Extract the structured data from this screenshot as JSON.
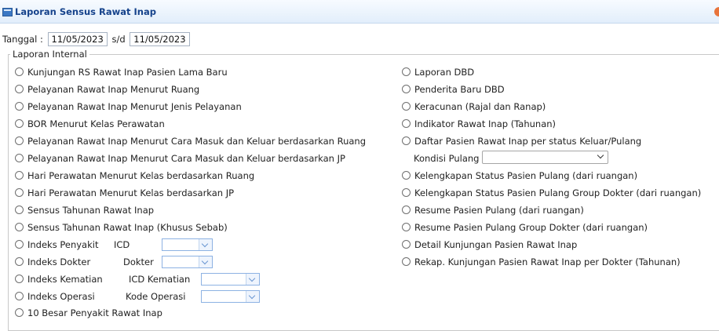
{
  "window": {
    "title": "Laporan Sensus Rawat Inap"
  },
  "filter": {
    "tanggal_label": "Tanggal :",
    "date_from": "11/05/2023",
    "sd_label": "s/d",
    "date_to": "11/05/2023"
  },
  "group": {
    "legend": "Laporan Internal"
  },
  "left_reports": [
    "Kunjungan RS Rawat Inap Pasien Lama Baru",
    "Pelayanan Rawat Inap Menurut Ruang",
    "Pelayanan Rawat Inap Menurut Jenis Pelayanan",
    "BOR Menurut Kelas Perawatan",
    "Pelayanan Rawat Inap Menurut Cara Masuk dan Keluar berdasarkan Ruang",
    "Pelayanan Rawat Inap Menurut Cara Masuk dan Keluar berdasarkan JP",
    "Hari Perawatan Menurut Kelas berdasarkan Ruang",
    "Hari Perawatan Menurut Kelas berdasarkan JP",
    "Sensus Tahunan Rawat Inap",
    "Sensus Tahunan Rawat Inap (Khusus Sebab)"
  ],
  "indeks": {
    "penyakit": {
      "label": "Indeks Penyakit",
      "field_label": "ICD"
    },
    "dokter": {
      "label": "Indeks Dokter",
      "field_label": "Dokter"
    },
    "kematian": {
      "label": "Indeks Kematian",
      "field_label": "ICD Kematian"
    },
    "operasi": {
      "label": "Indeks Operasi",
      "field_label": "Kode Operasi"
    }
  },
  "last_left": "10 Besar Penyakit Rawat Inap",
  "right_reports_top": [
    "Laporan DBD",
    "Penderita Baru DBD",
    "Keracunan (Rajal dan Ranap)",
    "Indikator Rawat Inap (Tahunan)",
    "Daftar Pasien Rawat Inap per status Keluar/Pulang"
  ],
  "kondisi": {
    "label": "Kondisi Pulang",
    "value": ""
  },
  "right_reports_bottom": [
    "Kelengkapan Status Pasien Pulang (dari ruangan)",
    "Kelengkapan Status Pasien Pulang Group Dokter (dari ruangan)",
    "Resume Pasien Pulang (dari ruangan)",
    "Resume Pasien Pulang Group Dokter (dari ruangan)",
    "Detail Kunjungan Pasien Rawat Inap",
    "Rekap. Kunjungan Pasien Rawat Inap per Dokter (Tahunan)"
  ]
}
